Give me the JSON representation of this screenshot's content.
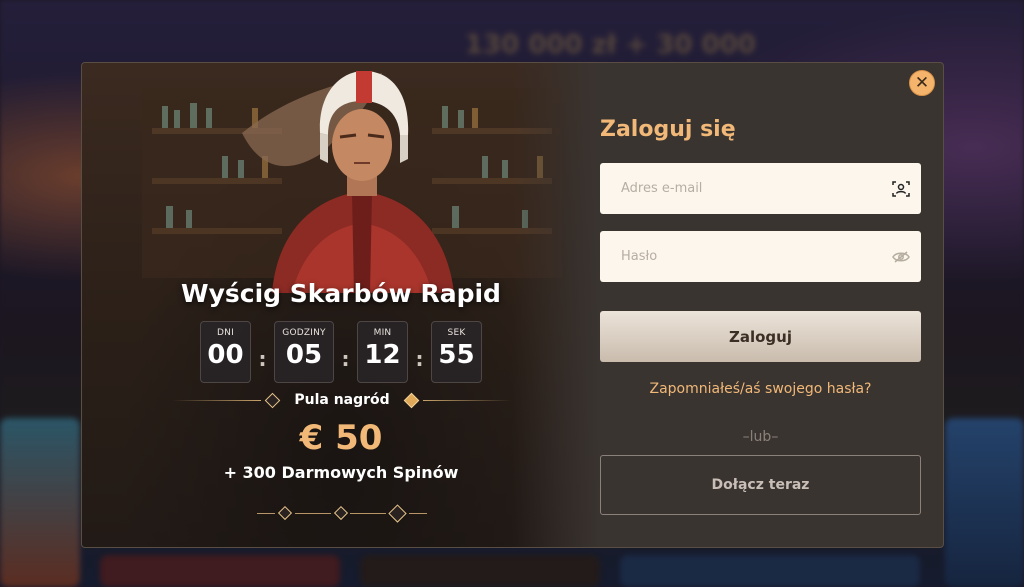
{
  "background": {
    "banner_text": "130 000 zł + 30 000"
  },
  "promo": {
    "title": "Wyścig Skarbów Rapid",
    "countdown": [
      {
        "label": "DNI",
        "value": "00"
      },
      {
        "label": "GODZINY",
        "value": "05"
      },
      {
        "label": "MIN",
        "value": "12"
      },
      {
        "label": "SEK",
        "value": "55"
      }
    ],
    "separator": ":",
    "pool_label": "Pula nagród",
    "prize_amount": "€ 50",
    "bonus": "+ 300 Darmowych Spinów"
  },
  "login": {
    "title": "Zaloguj się",
    "email_placeholder": "Adres e-mail",
    "password_placeholder": "Hasło",
    "login_button": "Zaloguj",
    "forgot_link": "Zapomniałeś/aś swojego hasła?",
    "or_text": "–lub–",
    "join_button": "Dołącz teraz",
    "close_symbol": "✕"
  },
  "colors": {
    "accent": "#f1b877",
    "modal_bg": "#3a3431",
    "field_bg": "#fcf6ec"
  },
  "icons": {
    "email_field": "user-scan-icon",
    "password_field": "eye-off-icon",
    "close": "close-icon"
  }
}
